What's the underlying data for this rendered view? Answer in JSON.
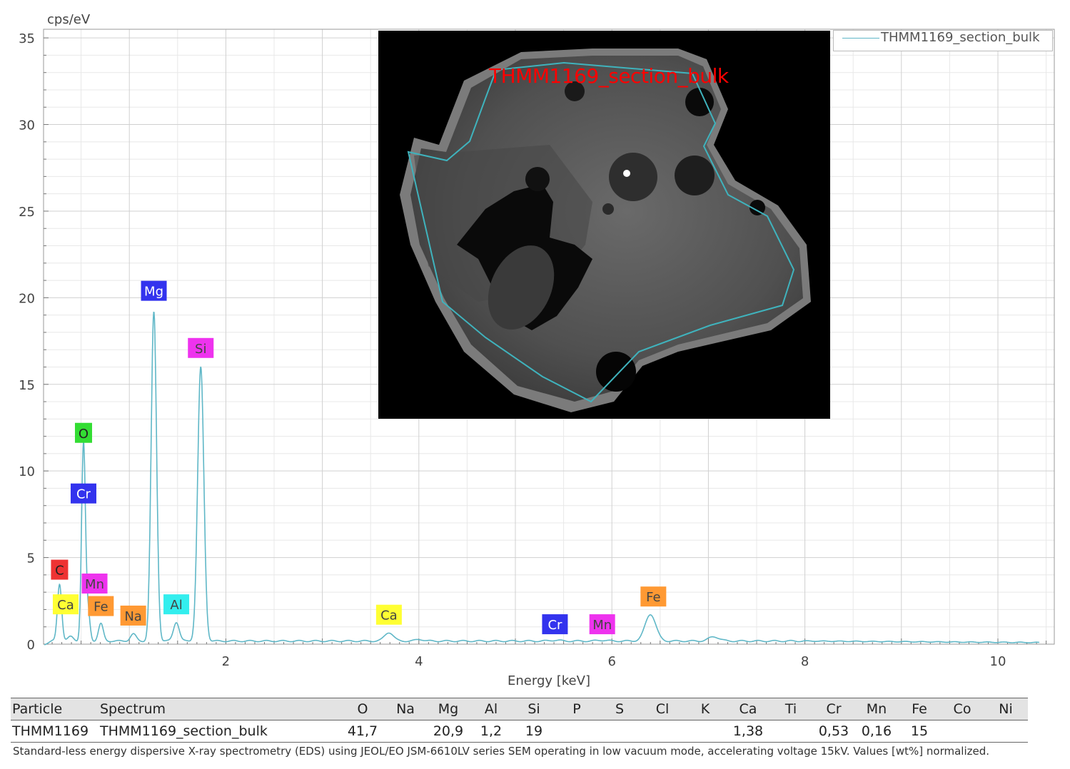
{
  "chart_data": {
    "type": "line",
    "ylabel": "cps/eV",
    "xlabel": "Energy [keV]",
    "xlim": [
      0,
      10.5
    ],
    "ylim": [
      0,
      35.5
    ],
    "x_ticks": [
      2,
      4,
      6,
      8,
      10
    ],
    "y_ticks": [
      0,
      5,
      10,
      15,
      20,
      25,
      30,
      35
    ],
    "grid": true,
    "legend_position": "top-right",
    "series": [
      {
        "name": "THMM1169_section_bulk",
        "color": "#5fb7c7",
        "baseline": 0.18,
        "peaks": [
          {
            "x": 0.277,
            "height": 3.3,
            "width": 0.022
          },
          {
            "x": 0.392,
            "height": 0.25,
            "width": 0.03
          },
          {
            "x": 0.525,
            "height": 11.4,
            "width": 0.02
          },
          {
            "x": 0.573,
            "height": 1.6,
            "width": 0.02
          },
          {
            "x": 0.705,
            "height": 1.0,
            "width": 0.025
          },
          {
            "x": 1.041,
            "height": 0.4,
            "width": 0.03
          },
          {
            "x": 1.254,
            "height": 19.0,
            "width": 0.028
          },
          {
            "x": 1.487,
            "height": 1.1,
            "width": 0.03
          },
          {
            "x": 1.74,
            "height": 15.8,
            "width": 0.032
          },
          {
            "x": 3.69,
            "height": 0.5,
            "width": 0.045
          },
          {
            "x": 4.01,
            "height": 0.1,
            "width": 0.04
          },
          {
            "x": 5.41,
            "height": 0.05,
            "width": 0.05
          },
          {
            "x": 5.9,
            "height": 0.05,
            "width": 0.05
          },
          {
            "x": 6.4,
            "height": 1.55,
            "width": 0.055
          },
          {
            "x": 7.06,
            "height": 0.25,
            "width": 0.055
          }
        ]
      }
    ],
    "peak_labels": [
      {
        "text": "C",
        "x": 0.277,
        "y": 4.3,
        "bg": "#ee3333",
        "fg": "#222222"
      },
      {
        "text": "Ca",
        "x": 0.34,
        "y": 2.3,
        "bg": "#ffff33",
        "fg": "#444444"
      },
      {
        "text": "O",
        "x": 0.525,
        "y": 12.2,
        "bg": "#33dd33",
        "fg": "#222222"
      },
      {
        "text": "Cr",
        "x": 0.525,
        "y": 8.7,
        "bg": "#3333ee",
        "fg": "#ffffff"
      },
      {
        "text": "Mn",
        "x": 0.64,
        "y": 3.5,
        "bg": "#ee33ee",
        "fg": "#444444"
      },
      {
        "text": "Fe",
        "x": 0.705,
        "y": 2.2,
        "bg": "#ff9933",
        "fg": "#444444"
      },
      {
        "text": "Na",
        "x": 1.04,
        "y": 1.65,
        "bg": "#ff9933",
        "fg": "#444444"
      },
      {
        "text": "Mg",
        "x": 1.254,
        "y": 20.4,
        "bg": "#3333ee",
        "fg": "#ffffff"
      },
      {
        "text": "Al",
        "x": 1.487,
        "y": 2.3,
        "bg": "#33eeee",
        "fg": "#444444"
      },
      {
        "text": "Si",
        "x": 1.74,
        "y": 17.1,
        "bg": "#ee33ee",
        "fg": "#444444"
      },
      {
        "text": "Ca",
        "x": 3.69,
        "y": 1.7,
        "bg": "#ffff33",
        "fg": "#444444"
      },
      {
        "text": "Cr",
        "x": 5.41,
        "y": 1.15,
        "bg": "#3333ee",
        "fg": "#ffffff"
      },
      {
        "text": "Mn",
        "x": 5.9,
        "y": 1.15,
        "bg": "#ee33ee",
        "fg": "#444444"
      },
      {
        "text": "Fe",
        "x": 6.43,
        "y": 2.75,
        "bg": "#ff9933",
        "fg": "#444444"
      }
    ]
  },
  "image": {
    "overlay_label": "THMM1169_section_bulk",
    "outline_color": "#3fb3bd"
  },
  "legend": {
    "label": "THMM1169_section_bulk"
  },
  "table": {
    "headers": [
      "Particle",
      "Spectrum",
      "O",
      "Na",
      "Mg",
      "Al",
      "Si",
      "P",
      "S",
      "Cl",
      "K",
      "Ca",
      "Ti",
      "Cr",
      "Mn",
      "Fe",
      "Co",
      "Ni"
    ],
    "rows": [
      [
        "THMM1169",
        "THMM1169_section_bulk",
        "41,7",
        "",
        "20,9",
        "1,2",
        "19",
        "",
        "",
        "",
        "",
        "1,38",
        "",
        "0,53",
        "0,16",
        "15",
        "",
        ""
      ]
    ]
  },
  "footnote": "Standard-less energy dispersive X-ray spectrometry (EDS) using JEOL/EO JSM-6610LV series SEM operating in low vacuum mode, accelerating voltage 15kV. Values [wt%] normalized."
}
